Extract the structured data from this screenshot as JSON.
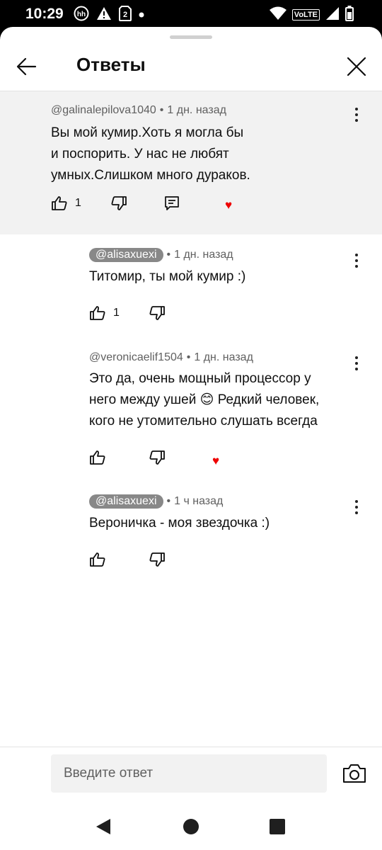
{
  "status": {
    "time": "10:29",
    "icons_left": [
      "hh-icon",
      "warning-icon",
      "sim-2-icon",
      "dot-icon"
    ],
    "icons_right": [
      "wifi-icon",
      "volte-icon",
      "signal-icon",
      "battery-icon"
    ],
    "volte_label": "VoLTE"
  },
  "header": {
    "title": "Ответы"
  },
  "top_comment": {
    "author": "@galinalepilova1040",
    "time": "1 дн. назад",
    "text_lines": [
      "Вы мой кумир.Хоть я  могла бы",
      "и поспорить. У нас не любят",
      "умных.Слишком много дураков."
    ],
    "likes": "1",
    "creator_heart": true
  },
  "replies": [
    {
      "author": "@alisaxuexi",
      "author_highlighted": true,
      "time": "1 дн. назад",
      "text_lines": [
        "Титомир, ты мой кумир :)"
      ],
      "likes": "1",
      "creator_heart": false
    },
    {
      "author": "@veronicaelif1504",
      "author_highlighted": false,
      "time": "1 дн. назад",
      "text_lines": [
        "Это да, очень мощный процессор у",
        "него между ушей 😊 Редкий человек,",
        "кого не утомительно слушать всегда"
      ],
      "likes": "",
      "creator_heart": true
    },
    {
      "author": "@alisaxuexi",
      "author_highlighted": true,
      "time": "1 ч назад",
      "text_lines": [
        "Вероничка - моя звездочка :)"
      ],
      "likes": "",
      "creator_heart": false
    }
  ],
  "reply_box": {
    "placeholder": "Введите ответ"
  },
  "colors": {
    "accent_heart": "#e00000",
    "highlight_bg": "#f2f2f2",
    "author_chip": "#888888"
  },
  "icons": {
    "back": "arrow-left-icon",
    "close": "close-icon",
    "like": "thumb-up-icon",
    "dislike": "thumb-down-icon",
    "reply": "reply-icon",
    "heart": "heart-icon",
    "more": "more-vert-icon",
    "camera": "camera-icon",
    "nav": [
      "back-triangle-icon",
      "home-circle-icon",
      "recents-square-icon"
    ]
  }
}
